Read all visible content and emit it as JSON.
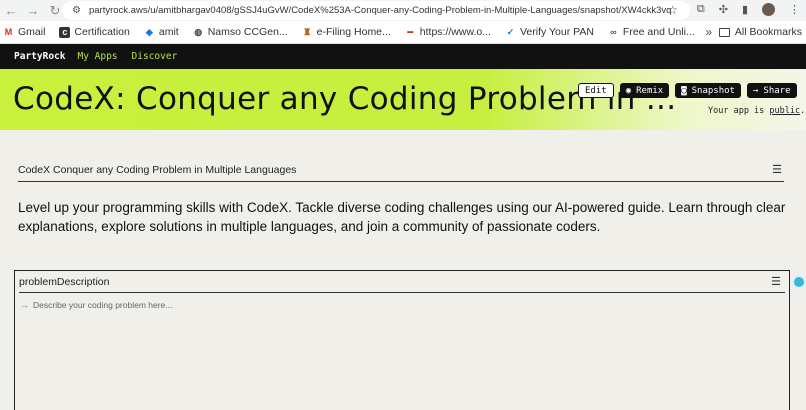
{
  "browser": {
    "url": "partyrock.aws/u/amitbhargav0408/gSSJ4uGvW/CodeX%253A-Conquer-any-Coding-Problem-in-Multiple-Languages/snapshot/XW4ckk3vq",
    "bookmarks": [
      {
        "label": "Gmail",
        "icon": "gmail-icon",
        "color": "#d93025"
      },
      {
        "label": "Certification",
        "icon": "certification-icon",
        "color": "#333333"
      },
      {
        "label": "amit",
        "icon": "amit-icon",
        "color": "#1a73e8"
      },
      {
        "label": "Namso CCGen...",
        "icon": "globe-icon",
        "color": "#444444"
      },
      {
        "label": "e-Filing Home...",
        "icon": "efiling-icon",
        "color": "#b5651d"
      },
      {
        "label": "https://www.o...",
        "icon": "site-icon",
        "color": "#c0392b"
      },
      {
        "label": "Verify Your PAN",
        "icon": "check-icon",
        "color": "#1a73e8"
      },
      {
        "label": "Free and Unli...",
        "icon": "infinity-icon",
        "color": "#555555"
      }
    ],
    "all_bookmarks": "All Bookmarks"
  },
  "nav": {
    "brand": "PartyRock",
    "links": [
      "My Apps",
      "Discover"
    ]
  },
  "hero": {
    "title": "CodeX: Conquer any Coding Problem in ...",
    "edit": "Edit",
    "remix": "Remix",
    "snapshot": "Snapshot",
    "share": "Share",
    "public_prefix": "Your app is ",
    "public_link": "public",
    "public_suffix": "."
  },
  "section": {
    "title": "CodeX Conquer any Coding Problem in Multiple Languages",
    "description": "Level up your programming skills with CodeX. Tackle diverse coding challenges using our AI-powered guide. Learn through clear explanations, explore solutions in multiple languages, and join a community of passionate coders."
  },
  "panel": {
    "title": "problemDescription",
    "placeholder": "Describe your coding problem here..."
  },
  "colors": {
    "accent": "#c8f03c",
    "nav_link": "#b5e04a",
    "nav_bg": "#111111",
    "page_bg": "#f0efea"
  }
}
